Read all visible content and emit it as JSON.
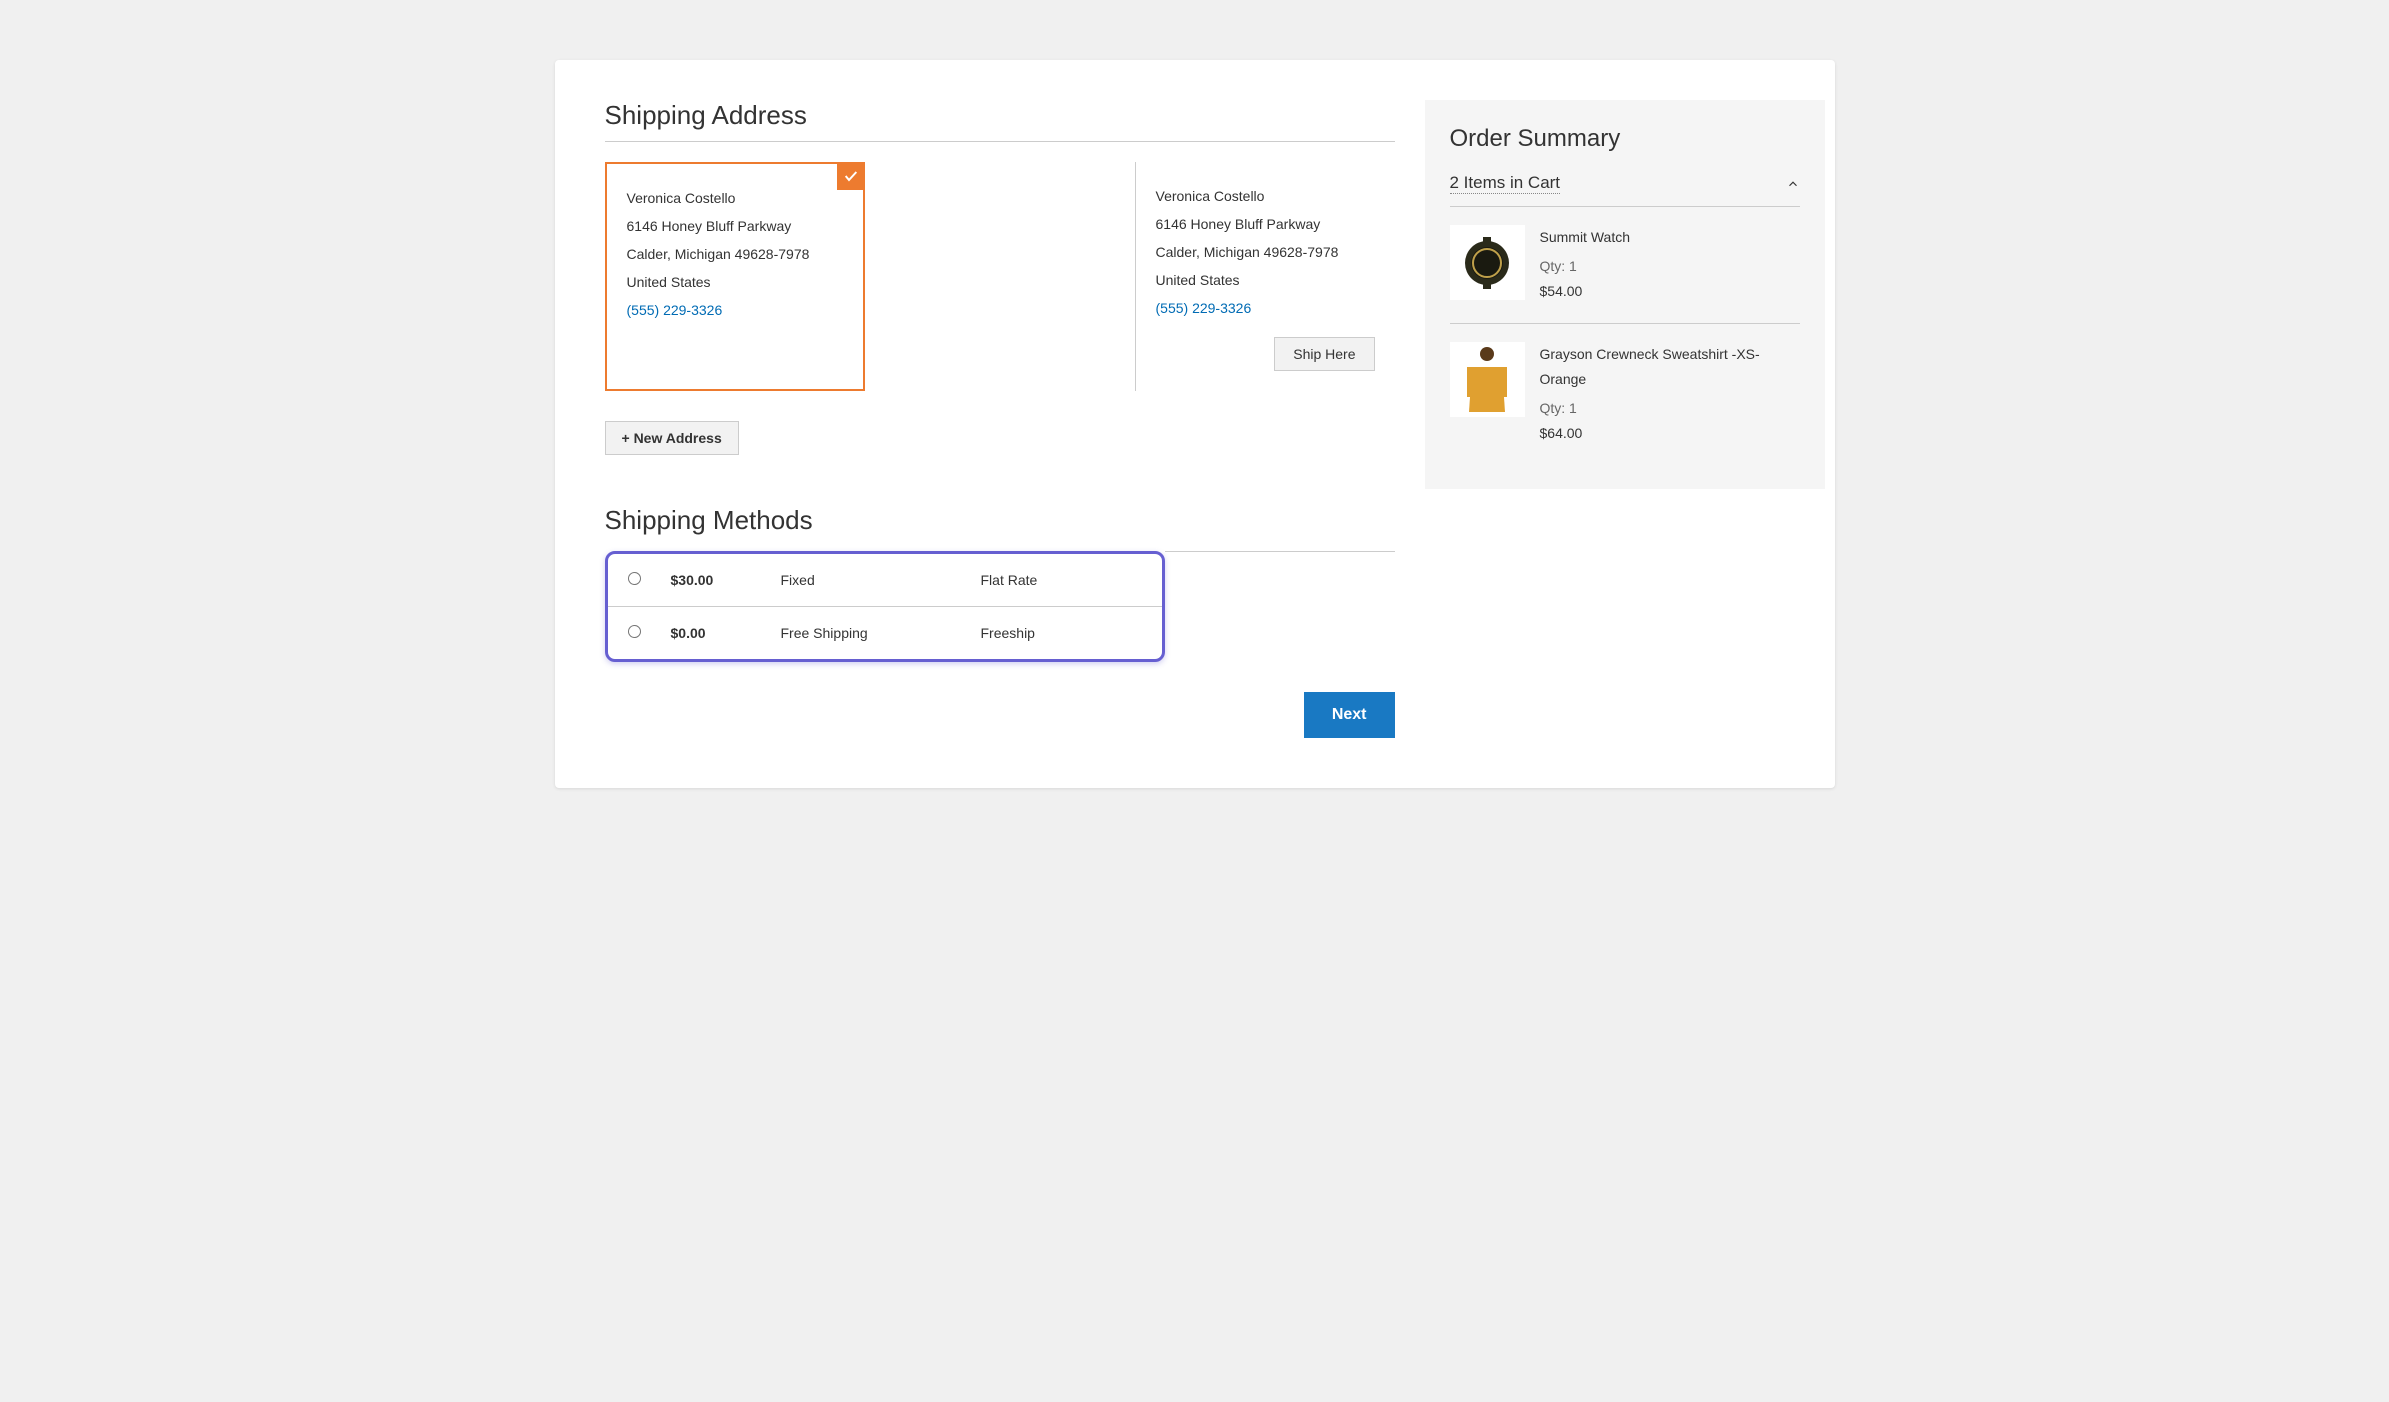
{
  "shipping": {
    "title": "Shipping Address",
    "addresses": [
      {
        "name": "Veronica Costello",
        "street": "6146 Honey Bluff Parkway",
        "city_region_zip": "Calder, Michigan 49628-7978",
        "country": "United States",
        "phone": "(555) 229-3326",
        "selected": true
      },
      {
        "name": "Veronica Costello",
        "street": "6146 Honey Bluff Parkway",
        "city_region_zip": "Calder, Michigan 49628-7978",
        "country": "United States",
        "phone": "(555) 229-3326",
        "selected": false
      }
    ],
    "ship_here_label": "Ship Here",
    "new_address_label": "+ New Address"
  },
  "methods": {
    "title": "Shipping Methods",
    "options": [
      {
        "price": "$30.00",
        "method": "Fixed",
        "carrier": "Flat Rate"
      },
      {
        "price": "$0.00",
        "method": "Free Shipping",
        "carrier": "Freeship"
      }
    ]
  },
  "next_label": "Next",
  "summary": {
    "title": "Order Summary",
    "items_in_cart_label": "2 Items in Cart",
    "items": [
      {
        "name": "Summit Watch",
        "qty_label": "Qty: 1",
        "price": "$54.00"
      },
      {
        "name": "Grayson Crewneck Sweatshirt -XS-Orange",
        "qty_label": "Qty: 1",
        "price": "$64.00"
      }
    ]
  }
}
